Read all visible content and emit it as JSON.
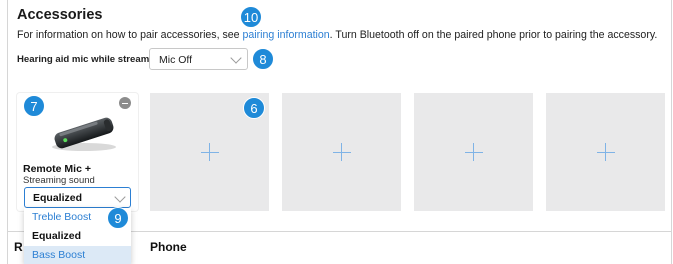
{
  "header": {
    "title": "Accessories",
    "intro_prefix": "For information on how to pair accessories, see ",
    "intro_link": "pairing information",
    "intro_suffix": ". Turn Bluetooth off on the paired phone prior to pairing the accessory."
  },
  "mic_setting": {
    "label": "Hearing aid mic while streaming",
    "value": "Mic Off"
  },
  "callouts": {
    "pairing_link": "10",
    "mic_select": "8",
    "accessory_card": "7",
    "empty_slot": "6",
    "sound_select": "9"
  },
  "accessory": {
    "name": "Remote Mic +",
    "subtitle": "Streaming sound",
    "sound_value": "Equalized",
    "options": [
      "Treble Boost",
      "Equalized",
      "Bass Boost"
    ]
  },
  "sections": {
    "left_partial": "R",
    "phone": "Phone"
  },
  "colors": {
    "accent": "#1f8ad8",
    "link": "#2c7fd3",
    "slot_bg": "#e9e9ea",
    "highlight_bg": "#dce9f6"
  },
  "icons": {
    "remove": "remove-icon",
    "add": "plus-icon",
    "chevron": "chevron-down-icon"
  }
}
